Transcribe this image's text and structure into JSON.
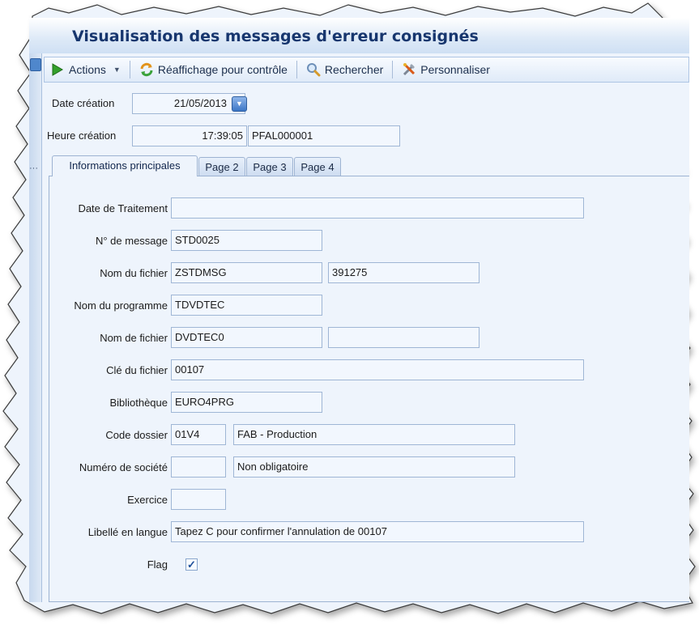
{
  "window": {
    "title": "Visualisation des messages d'erreur consignés",
    "rail_dots": "···"
  },
  "toolbar": {
    "actions_label": "Actions",
    "refresh_label": "Réaffichage pour contrôle",
    "search_label": "Rechercher",
    "customize_label": "Personnaliser"
  },
  "header": {
    "date_creation_label": "Date création",
    "date_creation_value": "21/05/2013",
    "heure_creation_label": "Heure création",
    "heure_creation_value": "17:39:05",
    "user_value": "PFAL000001"
  },
  "tabs": [
    {
      "label": "Informations principales",
      "active": true
    },
    {
      "label": "Page 2",
      "active": false
    },
    {
      "label": "Page 3",
      "active": false
    },
    {
      "label": "Page 4",
      "active": false
    }
  ],
  "form": {
    "date_traitement_label": "Date de Traitement",
    "date_traitement_value": "",
    "num_message_label": "N° de message",
    "num_message_value": "STD0025",
    "nom_fichier_label": "Nom du fichier",
    "nom_fichier_value": "ZSTDMSG",
    "nom_fichier_value2": "391275",
    "nom_programme_label": "Nom du programme",
    "nom_programme_value": "TDVDTEC",
    "nom_de_fichier_label": "Nom de fichier",
    "nom_de_fichier_value": "DVDTEC0",
    "nom_de_fichier_value2": "",
    "cle_fichier_label": "Clé du fichier",
    "cle_fichier_value": "00107",
    "bibliotheque_label": "Bibliothèque",
    "bibliotheque_value": "EURO4PRG",
    "code_dossier_label": "Code dossier",
    "code_dossier_value": "01V4",
    "code_dossier_desc": "FAB - Production",
    "num_societe_label": "Numéro de société",
    "num_societe_value": "",
    "num_societe_desc": "Non obligatoire",
    "exercice_label": "Exercice",
    "exercice_value": "",
    "libelle_label": "Libellé en langue",
    "libelle_value": "Tapez C pour confirmer l'annulation de 00107",
    "flag_label": "Flag",
    "flag_checked": true,
    "flag_mark": "✓"
  },
  "colors": {
    "title_text": "#17366e",
    "panel_bg": "#eef4fc",
    "input_border": "#9fb6d5",
    "check_color": "#1f4f9a"
  }
}
